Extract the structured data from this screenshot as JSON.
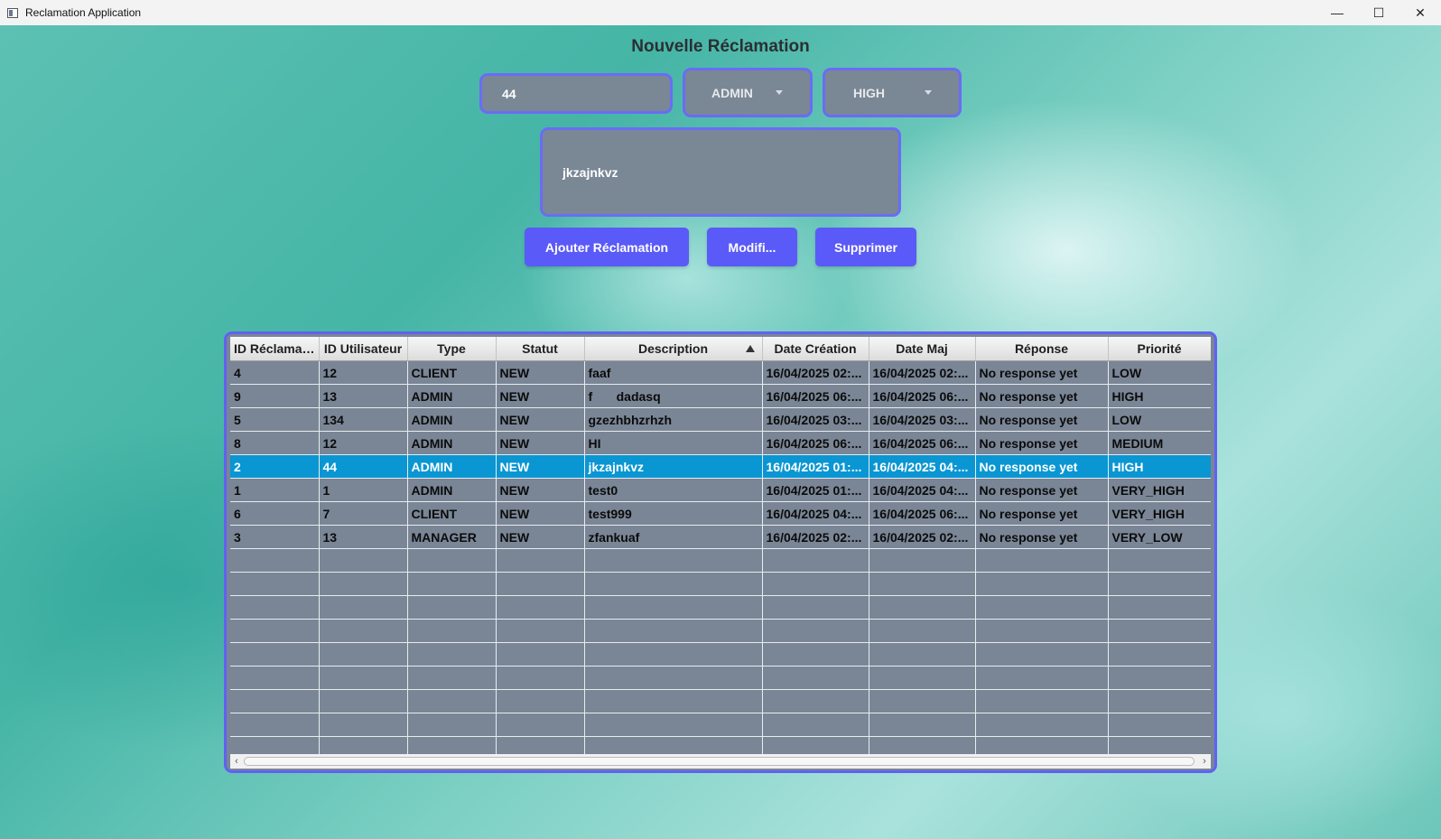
{
  "window": {
    "title": "Reclamation Application",
    "controls": [
      "—",
      "☐",
      "✕"
    ]
  },
  "form": {
    "title": "Nouvelle Réclamation",
    "id_value": "44",
    "type_selected": "ADMIN",
    "priority_selected": "HIGH",
    "description_value": "jkzajnkvz",
    "add_label": "Ajouter Réclamation",
    "modify_label": "Modifi...",
    "delete_label": "Supprimer"
  },
  "table": {
    "columns": [
      "ID Réclamat...",
      "ID Utilisateur",
      "Type",
      "Statut",
      "Description",
      "Date Création",
      "Date Maj",
      "Réponse",
      "Priorité"
    ],
    "sorted_column": "Description",
    "sort_direction": "ascending",
    "selected_row": 4,
    "rows": [
      [
        "4",
        "12",
        "CLIENT",
        "NEW",
        "faaf",
        "16/04/2025 02:...",
        "16/04/2025 02:...",
        "No response yet",
        "LOW"
      ],
      [
        "9",
        "13",
        "ADMIN",
        "NEW",
        "f\tdadasq",
        "16/04/2025 06:...",
        "16/04/2025 06:...",
        "No response yet",
        "HIGH"
      ],
      [
        "5",
        "134",
        "ADMIN",
        "NEW",
        "gzezhbhzrhzh",
        "16/04/2025 03:...",
        "16/04/2025 03:...",
        "No response yet",
        "LOW"
      ],
      [
        "8",
        "12",
        "ADMIN",
        "NEW",
        "HI",
        "16/04/2025 06:...",
        "16/04/2025 06:...",
        "No response yet",
        "MEDIUM"
      ],
      [
        "2",
        "44",
        "ADMIN",
        "NEW",
        "jkzajnkvz",
        "16/04/2025 01:...",
        "16/04/2025 04:...",
        "No response yet",
        "HIGH"
      ],
      [
        "1",
        "1",
        "ADMIN",
        "NEW",
        "test0",
        "16/04/2025 01:...",
        "16/04/2025 04:...",
        "No response yet",
        "VERY_HIGH"
      ],
      [
        "6",
        "7",
        "CLIENT",
        "NEW",
        "test999",
        "16/04/2025 04:...",
        "16/04/2025 06:...",
        "No response yet",
        "VERY_HIGH"
      ],
      [
        "3",
        "13",
        "MANAGER",
        "NEW",
        "zfankuaf",
        "16/04/2025 02:...",
        "16/04/2025 02:...",
        "No response yet",
        "VERY_LOW"
      ]
    ],
    "empty_row_count": 9
  },
  "colors": {
    "accent_border": "#6a6cf6",
    "button": "#5a5af8",
    "field_bg": "#7a8795",
    "selection": "#0a96d2"
  },
  "icons": {
    "minimize": "minimize-icon",
    "maximize": "maximize-icon",
    "close": "close-icon",
    "dropdown": "chevron-down-icon",
    "sort": "sort-ascending-icon"
  }
}
